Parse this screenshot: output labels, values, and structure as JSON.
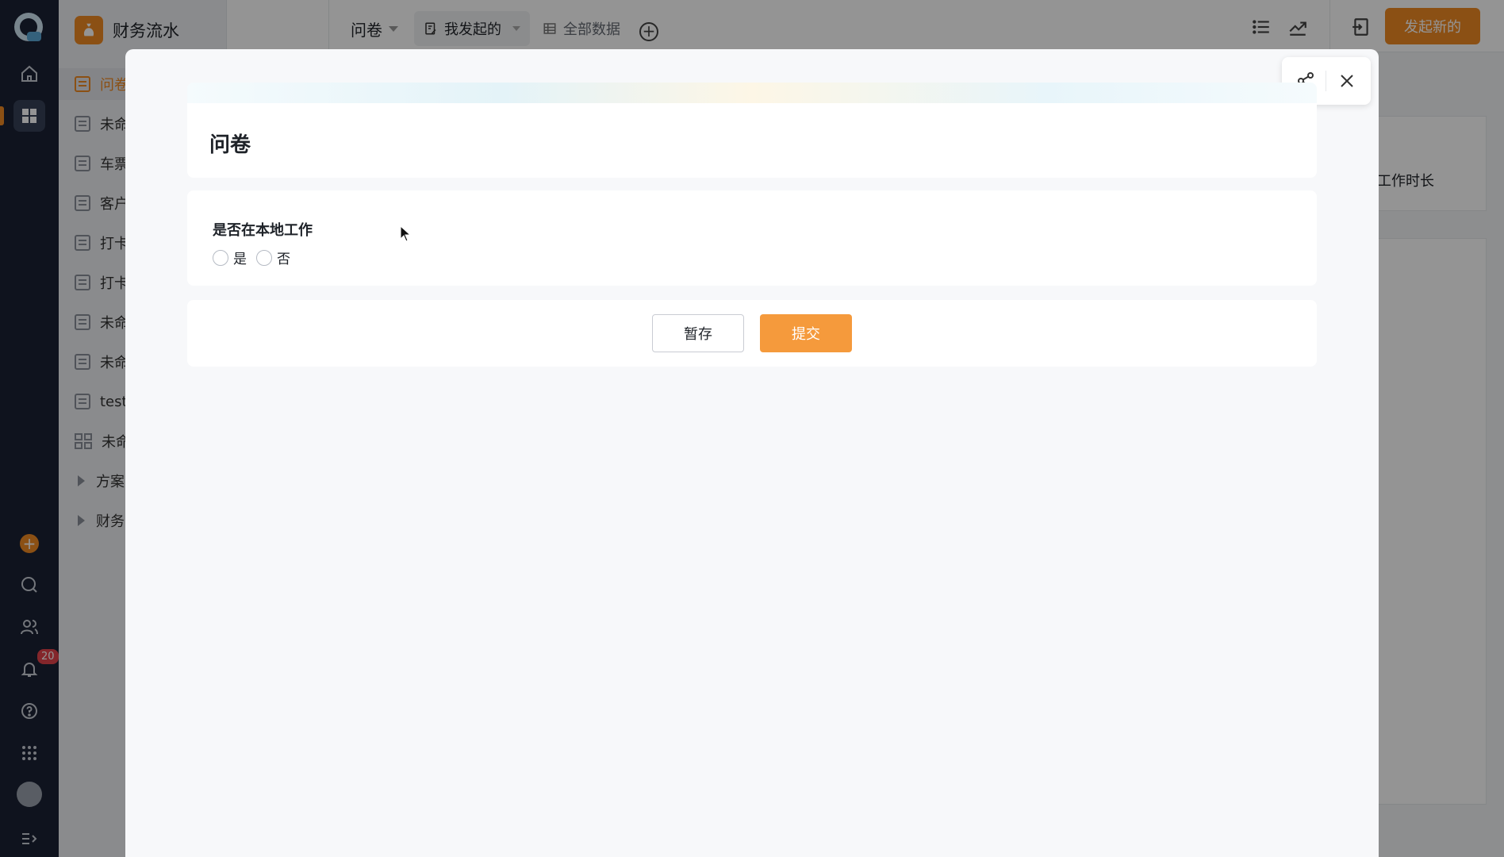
{
  "app": {
    "name": "财务流水",
    "more": "···",
    "add": "+"
  },
  "rail": {
    "badge_count": "20",
    "icons": [
      "app-logo-icon",
      "home-icon",
      "apps-icon",
      "add-icon",
      "search-icon",
      "contacts-icon",
      "bell-icon",
      "help-icon",
      "grid-apps-icon",
      "avatar",
      "collapse-icon"
    ]
  },
  "sidebar": {
    "items": [
      {
        "label": "问卷",
        "icon": "form-icon"
      },
      {
        "label": "未命",
        "icon": "form-icon"
      },
      {
        "label": "车票",
        "icon": "form-icon"
      },
      {
        "label": "客户",
        "icon": "form-icon"
      },
      {
        "label": "打卡",
        "icon": "form-icon"
      },
      {
        "label": "打卡",
        "icon": "form-icon"
      },
      {
        "label": "未命",
        "icon": "form-icon"
      },
      {
        "label": "未命",
        "icon": "form-icon"
      },
      {
        "label": "test",
        "icon": "form-icon"
      },
      {
        "label": "未命",
        "icon": "dashboard-icon"
      },
      {
        "label": "方案",
        "icon": "folder-caret-icon"
      },
      {
        "label": "财务",
        "icon": "folder-caret-icon"
      }
    ]
  },
  "topbar": {
    "view_name": "问卷",
    "tabs": [
      {
        "label": "我发起的",
        "icon": "edit-doc-icon"
      },
      {
        "label": "全部数据",
        "icon": "table-icon"
      }
    ],
    "add_view": "+",
    "new_button": "发起新的"
  },
  "background": {
    "column_header": "工作时长"
  },
  "modal": {
    "form_title": "问卷",
    "question": {
      "label": "是否在本地工作",
      "options": [
        "是",
        "否"
      ],
      "selected": null
    },
    "buttons": {
      "save": "暂存",
      "submit": "提交"
    }
  },
  "colors": {
    "accent": "#f08a24",
    "submit": "#f59a3c",
    "rail_bg": "#1a2134"
  }
}
